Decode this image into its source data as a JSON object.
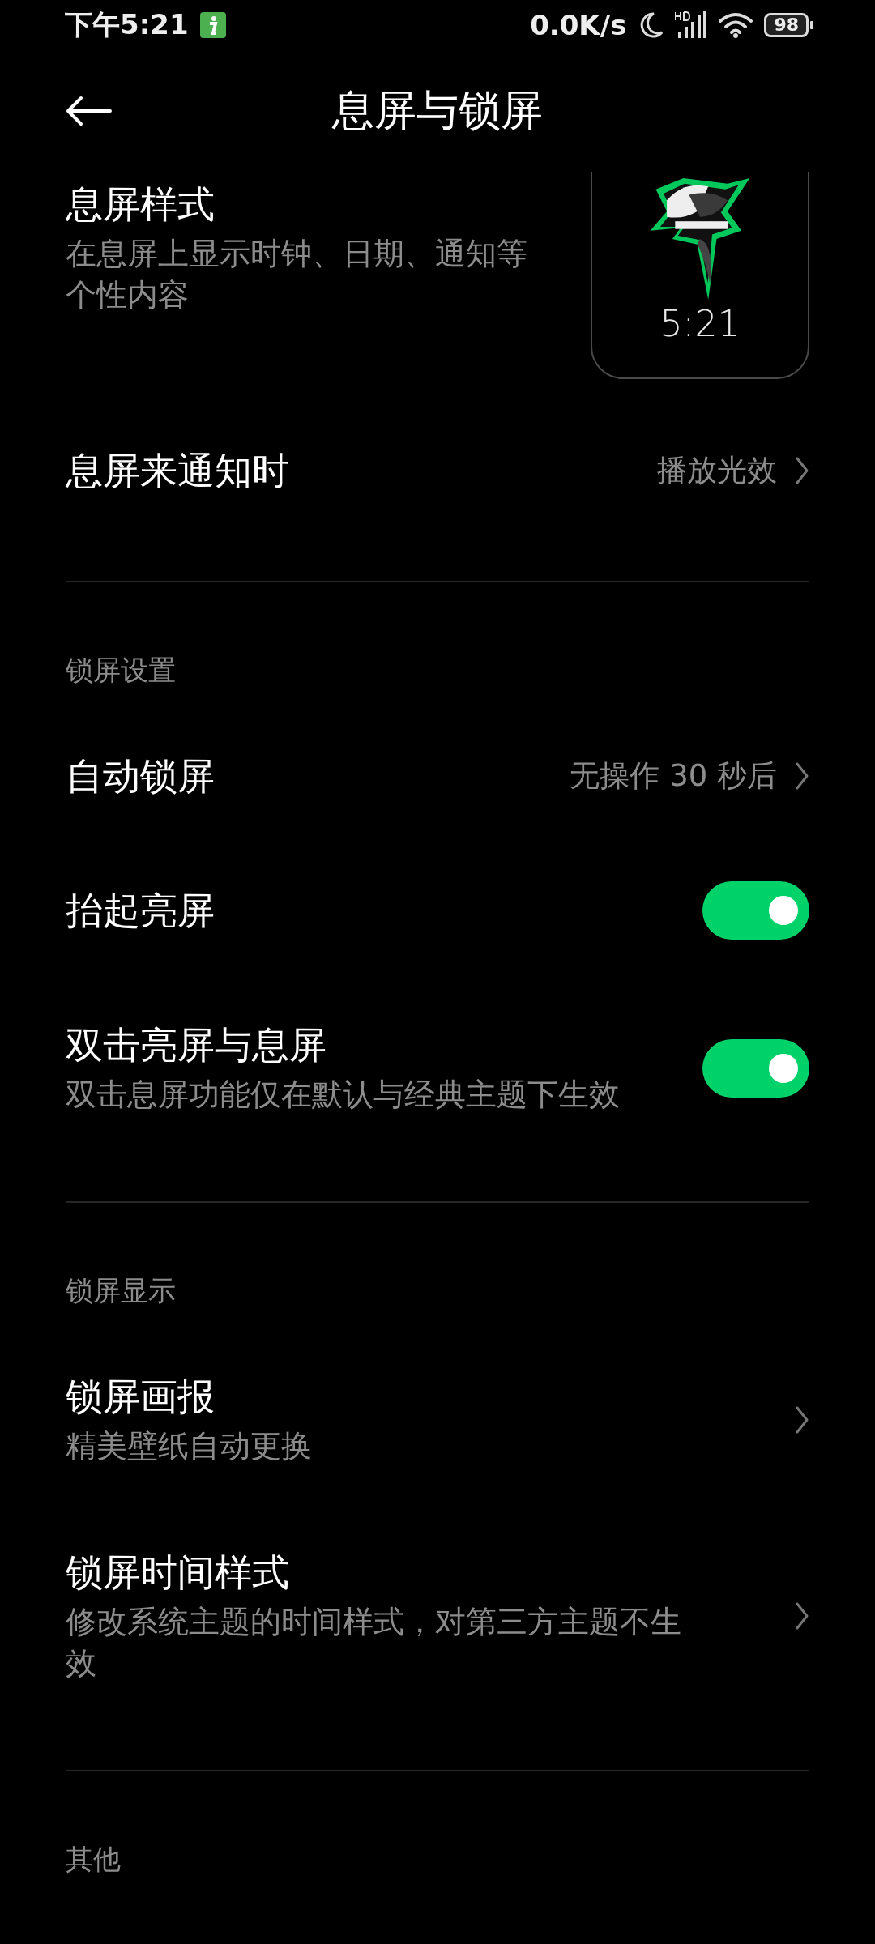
{
  "status_bar": {
    "time": "下午5:21",
    "net_speed": "0.0K/s",
    "battery": "98"
  },
  "header": {
    "title": "息屏与锁屏"
  },
  "sections": [
    {
      "items": [
        {
          "kind": "preview",
          "title": "息屏样式",
          "subtitle": "在息屏上显示时钟、日期、通知等个性内容",
          "preview_time": "5:21"
        },
        {
          "kind": "link",
          "title": "息屏来通知时",
          "value": "播放光效"
        }
      ]
    },
    {
      "title": "锁屏设置",
      "items": [
        {
          "kind": "link",
          "title": "自动锁屏",
          "value": "无操作 30 秒后"
        },
        {
          "kind": "toggle",
          "title": "抬起亮屏",
          "on": true
        },
        {
          "kind": "toggle",
          "title": "双击亮屏与息屏",
          "subtitle": "双击息屏功能仅在默认与经典主题下生效",
          "on": true
        }
      ]
    },
    {
      "title": "锁屏显示",
      "items": [
        {
          "kind": "link",
          "title": "锁屏画报",
          "subtitle": "精美壁纸自动更换"
        },
        {
          "kind": "link",
          "title": "锁屏时间样式",
          "subtitle": "修改系统主题的时间样式，对第三方主题不生效"
        }
      ]
    },
    {
      "title": "其他"
    }
  ]
}
